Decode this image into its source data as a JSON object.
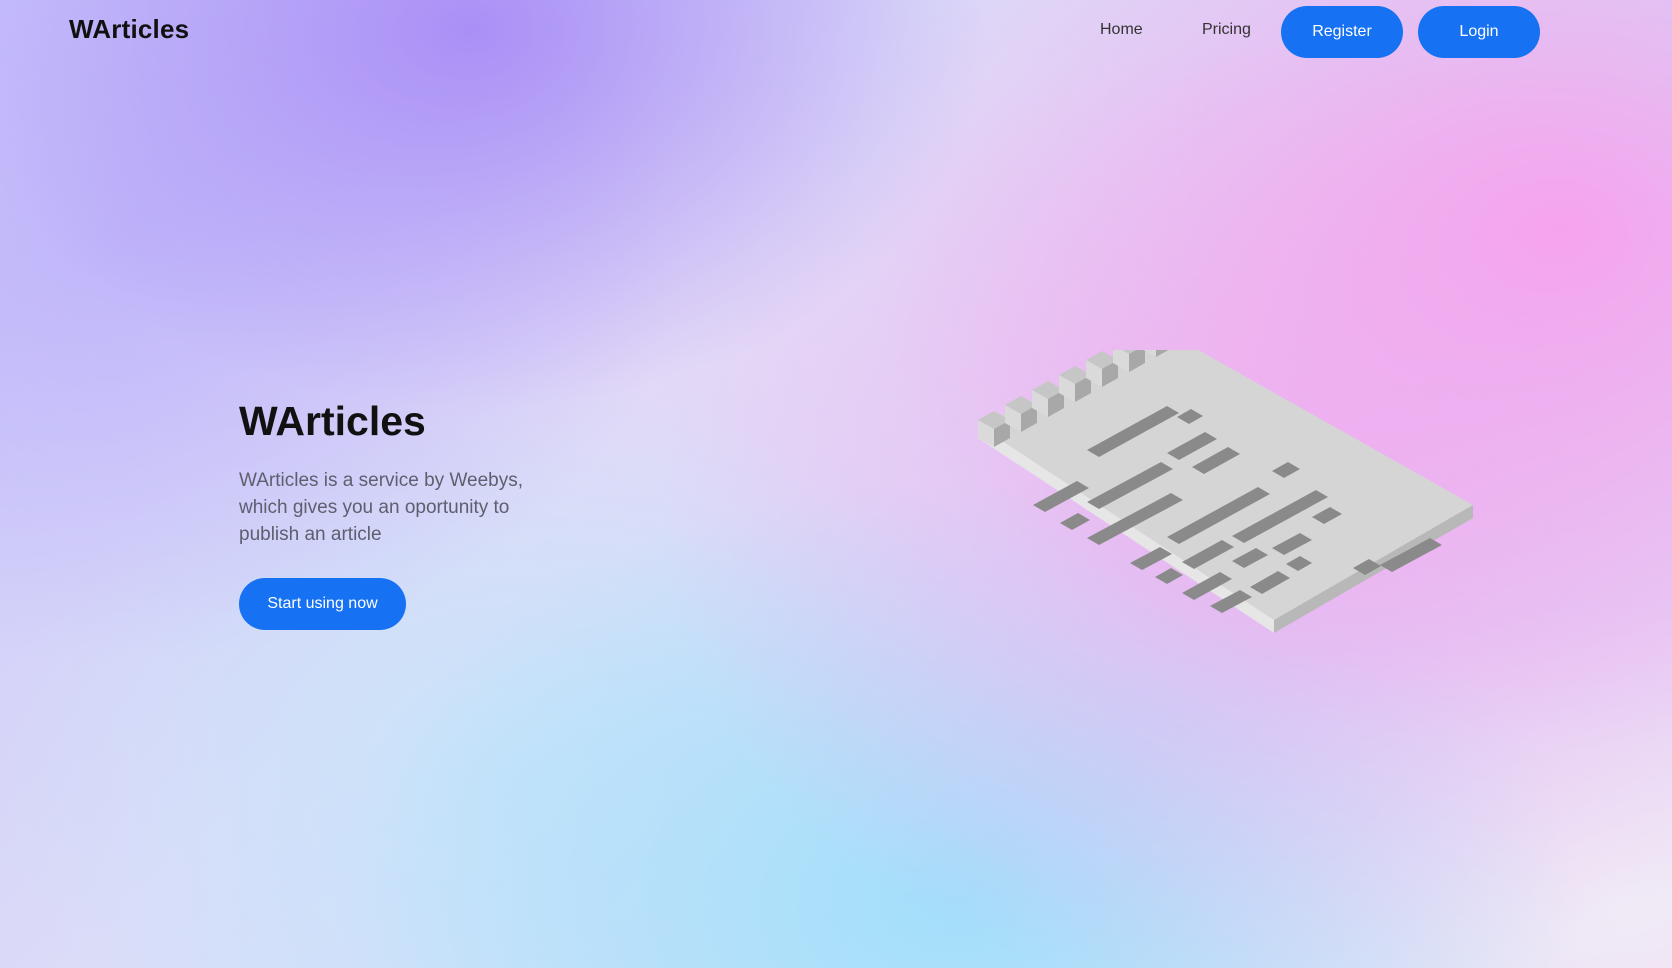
{
  "nav": {
    "brand": "WArticles",
    "home_label": "Home",
    "pricing_label": "Pricing",
    "register_label": "Register",
    "login_label": "Login"
  },
  "hero": {
    "title": "WArticles",
    "description": "WArticles is a service by Weebys, which gives you an oportunity to publish an article",
    "cta_label": "Start using now"
  },
  "illustration": {
    "icon": "isometric-document-illustration"
  },
  "colors": {
    "accent": "#1672f3",
    "title_text": "#111111",
    "body_text": "#5e5e6e"
  }
}
